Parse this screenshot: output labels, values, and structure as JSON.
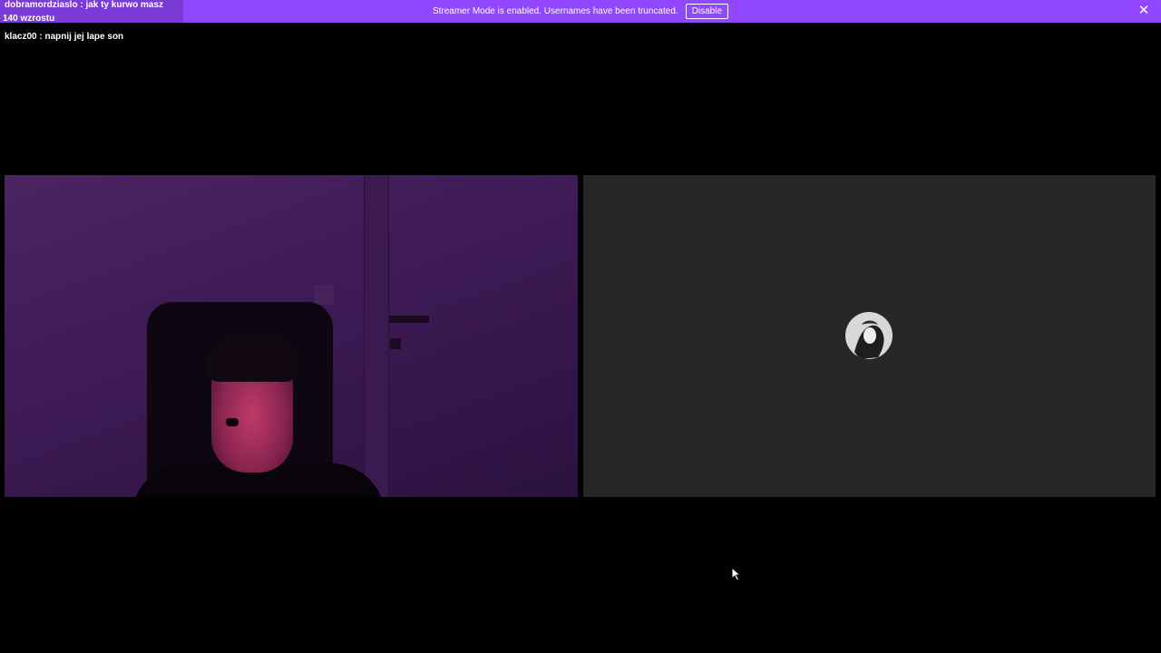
{
  "banner": {
    "message": "Streamer Mode is enabled. Usernames have been truncated.",
    "disable_label": "Disable",
    "close_glyph": "✕",
    "background_color": "#9146ff",
    "close_icon": "close-icon"
  },
  "chat": {
    "messages": [
      {
        "text": "dobramordziaslo : jak ty kurwo masz"
      },
      {
        "text": "140 wzrostu"
      },
      {
        "text": "klacz00 : napnij jej lape son"
      }
    ],
    "highlight_color": "#7b3bd6"
  },
  "tiles": {
    "left": {
      "kind": "webcam-feed"
    },
    "right": {
      "kind": "avatar-placeholder",
      "background_color": "#272727"
    }
  },
  "cursor": {
    "icon": "mouse-pointer-icon"
  }
}
